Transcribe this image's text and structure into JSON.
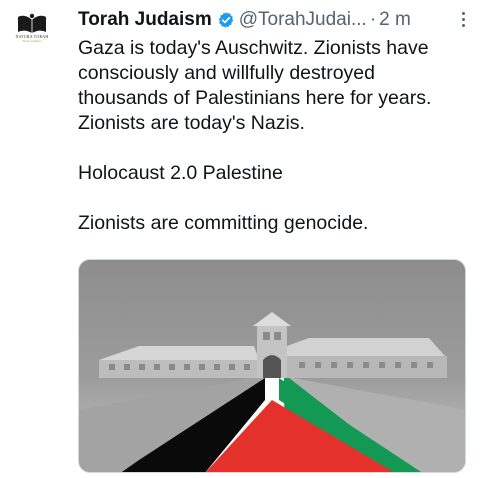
{
  "tweet": {
    "display_name": "Torah Judaism",
    "handle": "@TorahJudai...",
    "separator": "·",
    "time": "2 m",
    "lines": [
      "Gaza is today's Auschwitz. Zionists have",
      "consciously and willfully destroyed",
      "thousands of Palestinians here for years.",
      "Zionists are today's Nazis."
    ],
    "line2": "Holocaust 2.0 Palestine",
    "line3": "Zionists are committing genocide."
  },
  "avatar": {
    "title": "NATURA TORAH",
    "subtitle": "Torah Judaism"
  },
  "icons": {
    "verified": "verified-badge-icon",
    "more": "more-options-icon"
  },
  "colors": {
    "verified_blue": "#1d9bf0",
    "flag_black": "#000000",
    "flag_white": "#ffffff",
    "flag_green": "#149954",
    "flag_red": "#e4312b"
  }
}
